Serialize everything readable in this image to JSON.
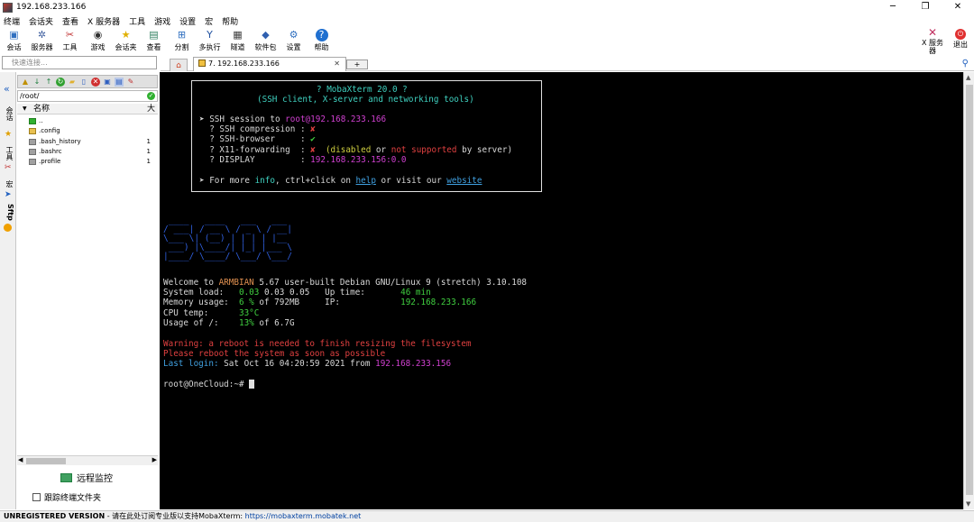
{
  "window": {
    "title": "192.168.233.166",
    "controls": [
      "─",
      "❐",
      "✕"
    ]
  },
  "menu": [
    "终端",
    "会话夹",
    "查看",
    "X 服务器",
    "工具",
    "游戏",
    "设置",
    "宏",
    "帮助"
  ],
  "toolbar": [
    {
      "label": "会话",
      "icon": "session-icon"
    },
    {
      "label": "服务器",
      "icon": "servers-icon"
    },
    {
      "label": "工具",
      "icon": "tools-icon"
    },
    {
      "label": "游戏",
      "icon": "games-icon"
    },
    {
      "label": "会话夹",
      "icon": "star-icon"
    },
    {
      "label": "查看",
      "icon": "view-icon"
    },
    {
      "label": "分割",
      "icon": "split-icon"
    },
    {
      "label": "多执行",
      "icon": "multiexec-icon"
    },
    {
      "label": "隧道",
      "icon": "tunnel-icon"
    },
    {
      "label": "软件包",
      "icon": "packages-icon"
    },
    {
      "label": "设置",
      "icon": "settings-icon"
    },
    {
      "label": "帮助",
      "icon": "help-icon"
    }
  ],
  "toolbar_right": {
    "xserver_label": "X 服务\n器",
    "exit_label": "退出"
  },
  "quick_connect": {
    "placeholder": "快速连接..."
  },
  "tabs": {
    "session_label": "7. 192.168.233.166",
    "close": "✕",
    "plus": "+"
  },
  "sidebar_strip": [
    "会话",
    "工具",
    "宏",
    "Sftp"
  ],
  "sftp": {
    "path": "/root/",
    "columns": {
      "name": "名称",
      "size": "大"
    },
    "rows": [
      {
        "name": "..",
        "type": "up",
        "size": ""
      },
      {
        "name": ".config",
        "type": "folder",
        "size": ""
      },
      {
        "name": ".bash_history",
        "type": "file",
        "size": "1"
      },
      {
        "name": ".bashrc",
        "type": "file",
        "size": "1"
      },
      {
        "name": ".profile",
        "type": "file",
        "size": "1"
      }
    ],
    "monitor_label": "远程监控",
    "follow_label": "跟踪终端文件夹"
  },
  "terminal": {
    "banner": {
      "title": "? MobaXterm 20.0 ?",
      "subtitle": "(SSH client, X-server and networking tools)",
      "session_prefix": "➤ SSH session to ",
      "session_user": "root",
      "session_host": "@192.168.233.166",
      "compression_label": "  ? SSH compression : ",
      "compression_value": "✘",
      "browser_label": "  ? SSH-browser     : ",
      "browser_value": "✔",
      "x11_label": "  ? X11-forwarding  : ",
      "x11_value": "✘",
      "x11_note_1": "  (disabled ",
      "x11_note_or": "or",
      "x11_note_2": " not supported",
      "x11_note_3": " by server)",
      "display_label": "  ? DISPLAY         : ",
      "display_value": "192.168.233.156:0.0",
      "more_1": "➤ For more ",
      "more_info": "info",
      "more_2": ", ctrl+click on ",
      "more_help": "help",
      "more_3": " or visit our ",
      "more_website": "website"
    },
    "ascii_art": " ____   ____   ___   ___\n/ ___| / __ \\ / _ \\ / __|\n\\___ \\| (__) | | | | |__\n ___) |\\____/| |_| |___ \\\n|____/ \\____/ \\___/ \\___/",
    "welcome_1": "Welcome to ",
    "welcome_os": "ARMBIAN",
    "welcome_2": " 5.67 user-built Debian GNU/Linux 9 (stretch) 3.10.108",
    "load_label": "System load:   ",
    "load_value": "0.03",
    "load_rest": " 0.03 0.05   Up time:       ",
    "uptime_value": "46 min",
    "mem_label": "Memory usage:  ",
    "mem_value": "6 %",
    "mem_rest": " of 792MB     IP:            ",
    "ip_value": "192.168.233.166",
    "cpu_label": "CPU temp:      ",
    "cpu_value": "33°C",
    "usage_label": "Usage of /:    ",
    "usage_value": "13%",
    "usage_rest": " of 6.7G",
    "warning": "Warning: a reboot is needed to finish resizing the filesystem",
    "reboot": "Please reboot the system as soon as possible",
    "last_login_label": "Last login:",
    "last_login_value": " Sat Oct 16 04:20:59 2021 from ",
    "last_login_ip": "192.168.233.156",
    "prompt": "root@OneCloud:~# "
  },
  "status": {
    "unregistered": "UNREGISTERED VERSION",
    "message": " - 请在此处订阅专业版以支持MobaXterm: ",
    "url": "https://mobaxterm.mobatek.net"
  }
}
